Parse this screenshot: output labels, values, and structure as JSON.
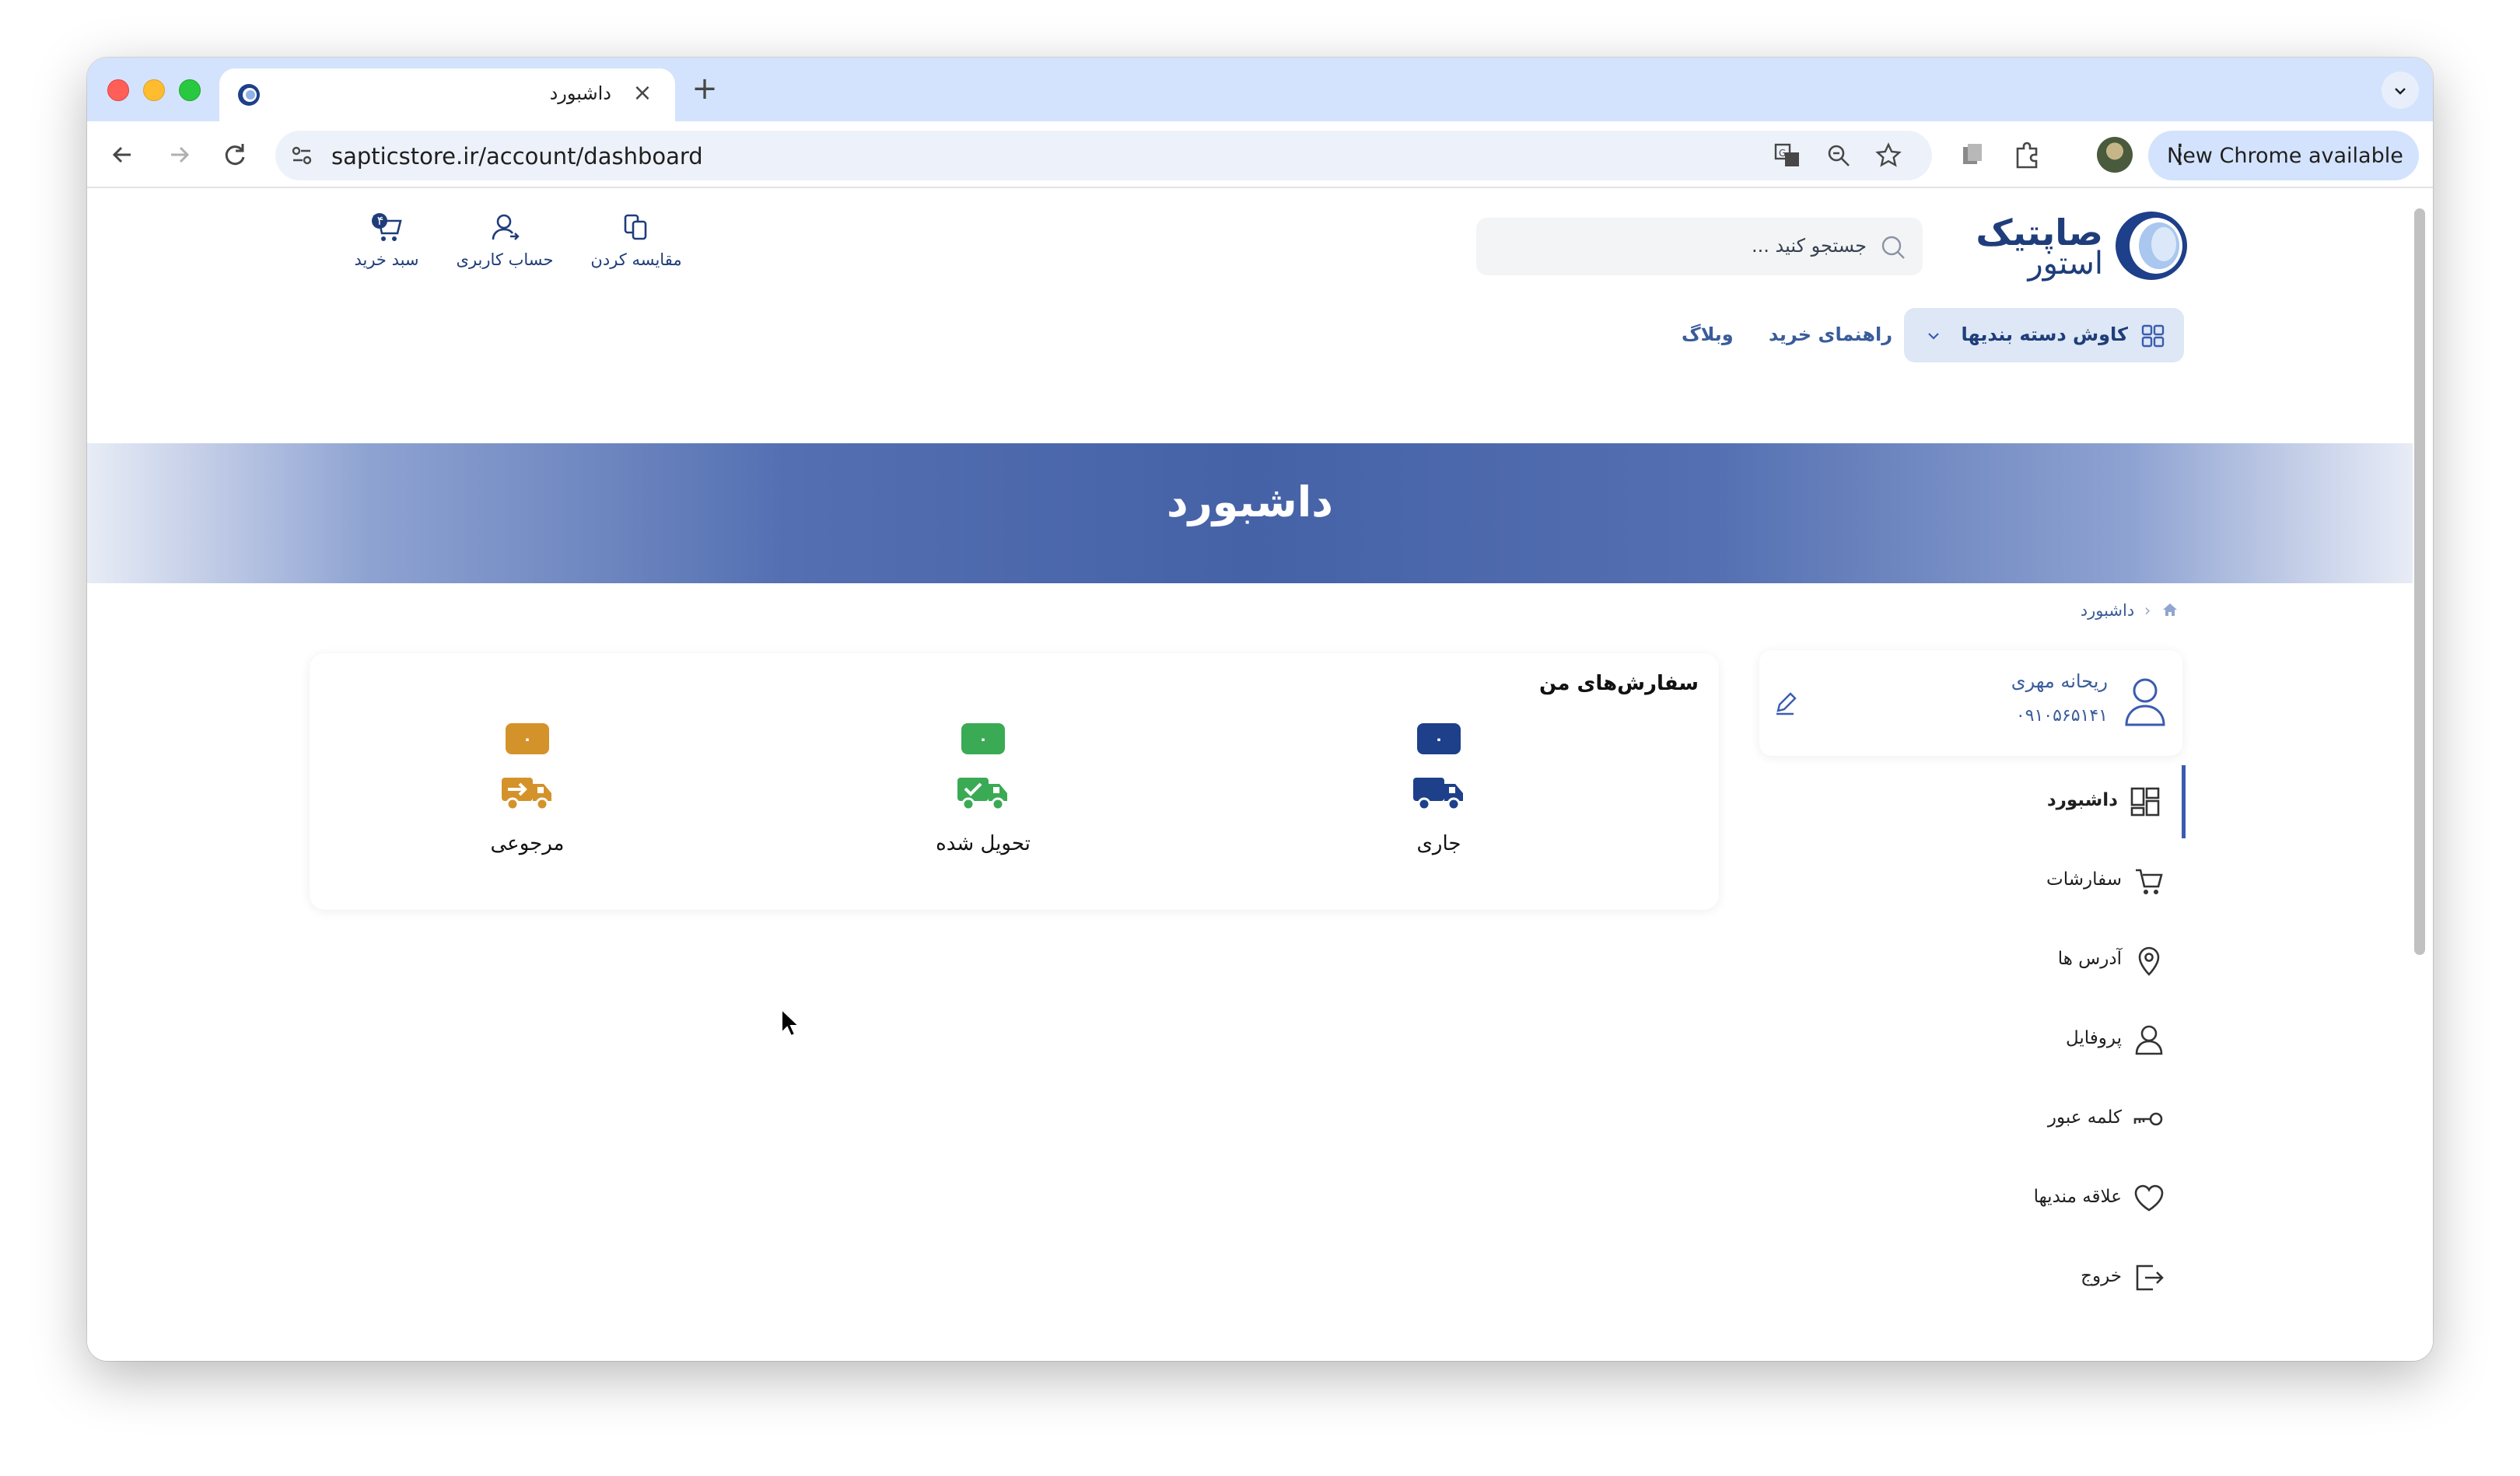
{
  "browser": {
    "tab_title": "داشبورد",
    "url": "sapticstore.ir/account/dashboard",
    "update_label": "New Chrome available"
  },
  "site": {
    "logo_line1": "صاپتیک",
    "logo_line2": "استور",
    "search_placeholder": "جستجو کنید ...",
    "header_actions": {
      "compare": "مقایسه کردن",
      "account": "حساب کاربری",
      "cart": "سبد خرید",
      "cart_count": "۴"
    },
    "menu": {
      "categories": "کاوش دسته بندیها",
      "guide": "راهنمای خرید",
      "blog": "وبلاگ"
    },
    "banner_title": "داشبورد",
    "breadcrumb": {
      "current": "داشبورد"
    }
  },
  "user": {
    "name": "ریحانه مهری",
    "phone": "۰۹۱۰۵۶۵۱۴۱"
  },
  "sidebar": {
    "items": [
      {
        "label": "داشبورد",
        "icon": "dashboard-icon",
        "active": true
      },
      {
        "label": "سفارشات",
        "icon": "cart-icon"
      },
      {
        "label": "آدرس ها",
        "icon": "location-icon"
      },
      {
        "label": "پروفایل",
        "icon": "profile-icon"
      },
      {
        "label": "کلمه عبور",
        "icon": "key-icon"
      },
      {
        "label": "علاقه مندیها",
        "icon": "heart-icon"
      },
      {
        "label": "خروج",
        "icon": "logout-icon"
      }
    ]
  },
  "orders": {
    "title": "سفارش‌های من",
    "items": [
      {
        "label": "جاری",
        "count": "۰",
        "color": "#1e3f8a"
      },
      {
        "label": "تحویل شده",
        "count": "۰",
        "color": "#3aaa55"
      },
      {
        "label": "مرجوعی",
        "count": "۰",
        "color": "#d4922b"
      }
    ]
  }
}
